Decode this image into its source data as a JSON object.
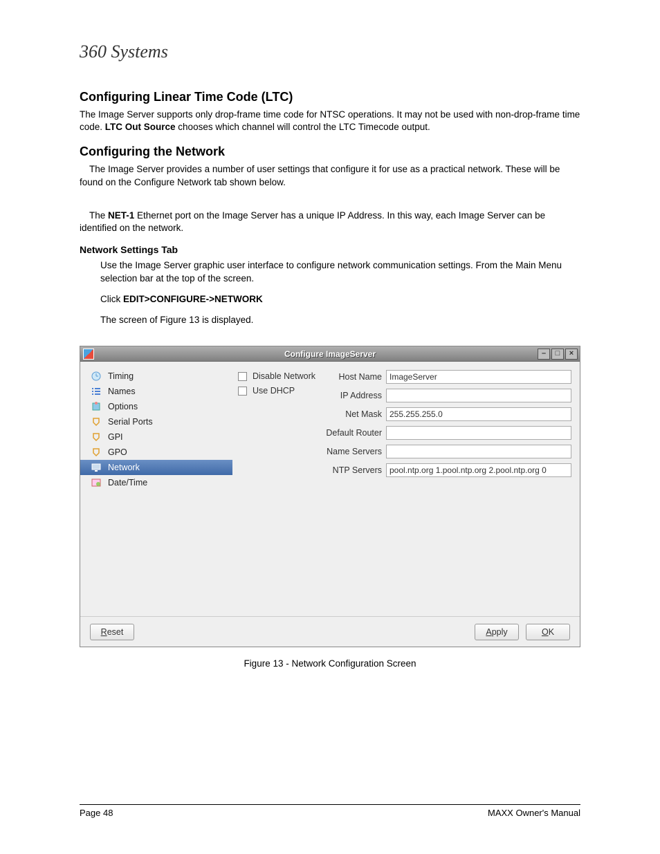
{
  "logo_text": "360 Systems",
  "section1": {
    "heading": "Configuring Linear Time Code (LTC)",
    "para_a": "The Image Server supports only drop-frame time code for NTSC operations. It may not be used with non-drop-frame time code. ",
    "para_b_bold": "LTC Out Source",
    "para_c": " chooses which channel will control the LTC Timecode output."
  },
  "section2": {
    "heading": "Configuring the Network",
    "para1": "The Image Server provides a number of user settings that configure it for use as a practical network. These will be found on the Configure Network tab shown below.",
    "para2_a": "The ",
    "para2_bold": "NET-1",
    "para2_b": " Ethernet port on the Image Server has a unique IP Address.  In this way, each Image Server can be identified on the network."
  },
  "net_tab": {
    "heading": "Network Settings Tab",
    "para1": "Use the Image Server graphic user interface to configure network communication settings. From the Main Menu selection bar at the top of the screen.",
    "click_a": "Click ",
    "click_b_bold": "EDIT>CONFIGURE->NETWORK",
    "para2": "The screen of Figure 13 is displayed."
  },
  "dialog": {
    "title": "Configure ImageServer",
    "sidebar": [
      "Timing",
      "Names",
      "Options",
      "Serial Ports",
      "GPI",
      "GPO",
      "Network",
      "Date/Time"
    ],
    "checks": {
      "disable": "Disable Network",
      "dhcp": "Use DHCP"
    },
    "fields": {
      "host_label": "Host Name",
      "host_value": "ImageServer",
      "ip_label": "IP Address",
      "ip_value": "",
      "mask_label": "Net Mask",
      "mask_value": "255.255.255.0",
      "router_label": "Default Router",
      "router_value": "",
      "ns_label": "Name Servers",
      "ns_value": "",
      "ntp_label": "NTP Servers",
      "ntp_value": "pool.ntp.org  1.pool.ntp.org  2.pool.ntp.org  0"
    },
    "buttons": {
      "reset": "Reset",
      "apply": "Apply",
      "ok": "OK"
    }
  },
  "caption": "Figure 13 - Network Configuration Screen",
  "footer": {
    "left": "Page 48",
    "right": "MAXX Owner's Manual"
  }
}
